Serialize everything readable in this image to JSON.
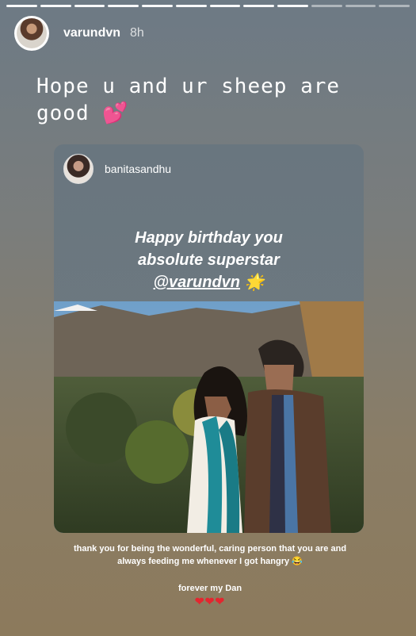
{
  "story": {
    "progress": {
      "segments": 12,
      "completed": 9
    },
    "author": {
      "username": "varundvn",
      "time": "8h"
    },
    "caption": {
      "text": "Hope u and ur sheep are good",
      "emoji": "two-hearts"
    },
    "shared_post": {
      "username": "banitasandhu",
      "text_line1": "Happy birthday you",
      "text_line2": "absolute superstar",
      "mention": "@varundvn",
      "emoji": "glowing-star"
    },
    "footer": {
      "line1": "thank you for being the wonderful, caring person that you are and always feeding me whenever I got hangry",
      "line1_emoji": "😂",
      "line2": "forever my Dan",
      "hearts": "❤❤❤"
    }
  }
}
